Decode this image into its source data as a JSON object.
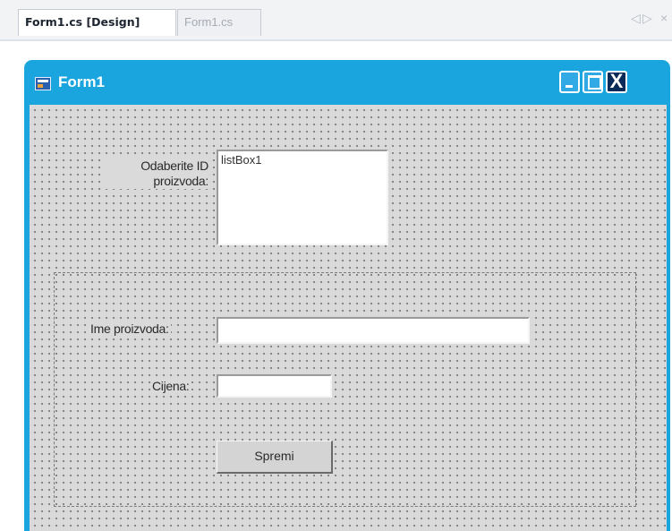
{
  "tabs": [
    {
      "label": "Form1.cs [Design]",
      "active": true
    },
    {
      "label": "Form1.cs",
      "active": false
    }
  ],
  "tab_nav": {
    "prev_icon": "arrow-left-icon",
    "next_icon": "arrow-right-icon",
    "close_icon": "close-icon",
    "prev": "◁",
    "next": "▷",
    "close": "×"
  },
  "form": {
    "title": "Form1",
    "title_icon": "form-window-icon",
    "close_glyph": "X",
    "colors": {
      "titlebar": "#1aa5df",
      "client": "#d9d9d9",
      "close_button": "#0a2b57"
    }
  },
  "controls": {
    "product_id_label": "Odaberite ID proizvoda:",
    "listbox_text": "listBox1",
    "product_name_label": "Ime proizvoda:",
    "product_name_value": "",
    "price_label": "Cijena:",
    "price_value": "",
    "save_button": "Spremi"
  }
}
